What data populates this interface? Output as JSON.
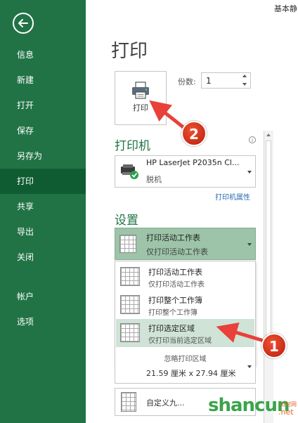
{
  "sidebar": {
    "items": [
      {
        "label": "信息"
      },
      {
        "label": "新建"
      },
      {
        "label": "打开"
      },
      {
        "label": "保存"
      },
      {
        "label": "另存为"
      },
      {
        "label": "打印"
      },
      {
        "label": "共享"
      },
      {
        "label": "导出"
      },
      {
        "label": "关闭"
      },
      {
        "label": "帐户"
      },
      {
        "label": "选项"
      }
    ],
    "active_index": 5
  },
  "top_right_text": "基本静",
  "page_title": "打印",
  "print_button": {
    "label": "打印"
  },
  "copies": {
    "label": "份数:",
    "value": "1"
  },
  "printer_section": {
    "title": "打印机",
    "printer_name": "HP LaserJet P2035n Cl...",
    "printer_status": "脱机",
    "properties_link": "打印机属性",
    "info_icon": "i"
  },
  "settings_section": {
    "title": "设置",
    "selected": {
      "title": "打印活动工作表",
      "subtitle": "仅打印活动工作表"
    },
    "options": [
      {
        "title": "打印活动工作表",
        "subtitle": "仅打印活动工作表",
        "highlighted": false
      },
      {
        "title": "打印整个工作簿",
        "subtitle": "打印整个工作簿",
        "highlighted": false
      },
      {
        "title": "打印选定区域",
        "subtitle": "仅打印当前选定区域",
        "highlighted": true
      }
    ],
    "ignore_print_area": "忽略打印区域",
    "paper_size": "21.59 厘米 x 27.94 厘米",
    "custom_scaling": "自定义九..."
  },
  "annotations": [
    {
      "number": "1",
      "color": "#d9321f"
    },
    {
      "number": "2",
      "color": "#d9321f"
    }
  ],
  "watermark": {
    "text": "shancun",
    "sub": "山村网",
    "net": ".net"
  },
  "colors": {
    "sidebar": "#217346",
    "sidebar_active": "#0f5c33",
    "accent": "#217346",
    "selection": "#9dc4a8",
    "arrow": "#e8413a"
  }
}
